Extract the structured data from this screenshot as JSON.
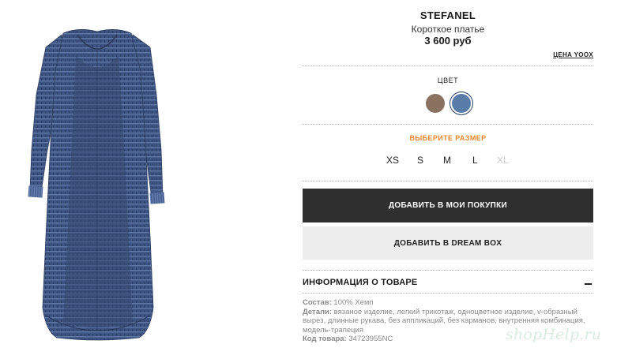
{
  "product": {
    "brand": "STEFANEL",
    "name": "Короткое платье",
    "price": "3 600 руб",
    "price_note": "ЦЕНА YOOX"
  },
  "colors": {
    "label": "ЦВЕТ",
    "swatches": [
      {
        "name": "brown",
        "hex": "#8a7260"
      },
      {
        "name": "blue",
        "hex": "#5a7ca8",
        "selected": true
      }
    ]
  },
  "sizes": {
    "label": "ВЫБЕРИТЕ РАЗМЕР",
    "label_color": "#e8862a",
    "options": [
      {
        "label": "XS",
        "available": true
      },
      {
        "label": "S",
        "available": true
      },
      {
        "label": "M",
        "available": true
      },
      {
        "label": "L",
        "available": true
      },
      {
        "label": "XL",
        "available": false
      }
    ]
  },
  "actions": {
    "add_to_cart": "ДОБАВИТЬ В МОИ ПОКУПКИ",
    "add_to_dreambox": "ДОБАВИТЬ В DREAM BOX"
  },
  "info": {
    "title": "ИНФОРМАЦИЯ О ТОВАРЕ",
    "composition_label": "Состав:",
    "composition_value": "100% Хемп",
    "details_label": "Детали:",
    "details_value": "вязаное изделие, легкий трикотаж, одноцветное изделие, v-образный вырез, длинные рукава, без аппликаций, без карманов, внутренняя комбинация, модель-трапеция",
    "code_label": "Код товара:",
    "code_value": "34723955NC"
  },
  "watermark": "shopHelp.ru"
}
